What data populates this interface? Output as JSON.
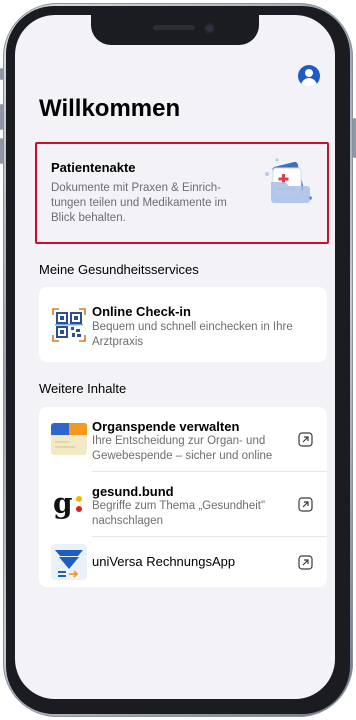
{
  "header": {
    "title": "Willkommen",
    "avatar_icon": "person-icon"
  },
  "patient_record": {
    "title": "Patientenakte",
    "description": "Dokumente mit Praxen & Einrich-tungen teilen und Medikamente im Blick behalten."
  },
  "health_services": {
    "label": "Meine Gesundheitsservices",
    "items": [
      {
        "title": "Online Check-in",
        "description": "Bequem und schnell einchecken in Ihre Arztpraxis",
        "icon": "qr-code-icon"
      }
    ]
  },
  "more_content": {
    "label": "Weitere Inhalte",
    "items": [
      {
        "title": "Organspende verwalten",
        "description": "Ihre Entscheidung zur Organ- und Gewebespende – sicher und online",
        "icon": "organ-donation-card-icon"
      },
      {
        "title": "gesund.bund",
        "description": "Begriffe zum Thema „Gesundheit\" nachschlagen",
        "icon": "gesund-bund-logo-icon"
      },
      {
        "title": "uniVersa RechnungsApp",
        "description": "",
        "icon": "universa-logo-icon"
      }
    ]
  },
  "colors": {
    "background": "#f2f2f7",
    "accent": "#1f5bc7",
    "highlight_border": "#c8102e"
  }
}
